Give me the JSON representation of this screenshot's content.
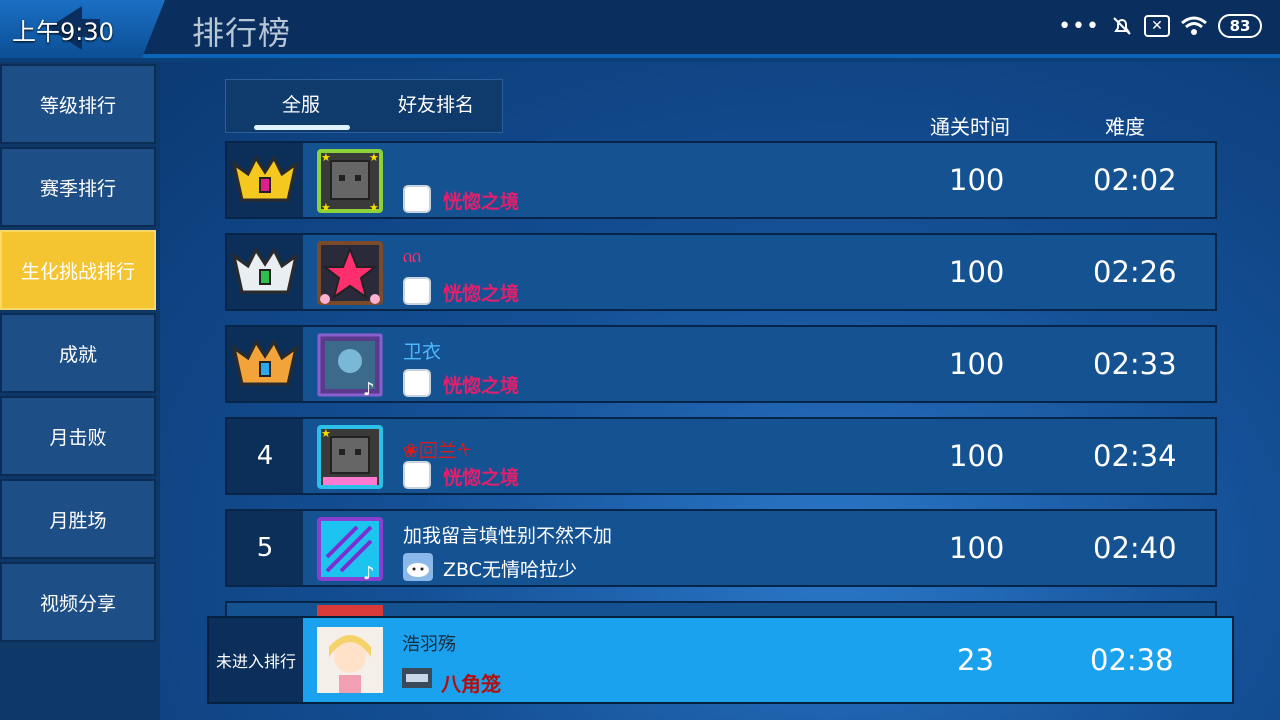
{
  "status_bar": {
    "time": "上午9:30",
    "battery": "83",
    "dots": "•••"
  },
  "header": {
    "title": "排行榜"
  },
  "sidebar": {
    "items": [
      {
        "label": "等级排行"
      },
      {
        "label": "赛季排行"
      },
      {
        "label": "生化挑战排行",
        "active": true
      },
      {
        "label": "成就"
      },
      {
        "label": "月击败"
      },
      {
        "label": "月胜场"
      },
      {
        "label": "视频分享"
      }
    ]
  },
  "tabs": [
    {
      "label": "全服",
      "selected": true
    },
    {
      "label": "好友排名"
    }
  ],
  "columns": {
    "clear_time": "通关时间",
    "difficulty": "难度"
  },
  "rows": [
    {
      "rank": "",
      "medal": "gold",
      "name": "",
      "subtitle": "恍惚之境",
      "score": "100",
      "time": "02:02"
    },
    {
      "rank": "",
      "medal": "silver",
      "name": "ᦶ",
      "subtitle": "恍惚之境",
      "score": "100",
      "time": "02:26"
    },
    {
      "rank": "",
      "medal": "bronze",
      "name": "卫衣",
      "subtitle": "恍惚之境",
      "score": "100",
      "time": "02:33"
    },
    {
      "rank": "4",
      "name": "❀回兰ᠰ",
      "subtitle": "恍惚之境",
      "score": "100",
      "time": "02:34"
    },
    {
      "rank": "5",
      "name": "加我留言填性别不然不加",
      "subtitle": "ZBC无情哈拉少",
      "score": "100",
      "time": "02:40"
    }
  ],
  "self_row": {
    "label": "未进入排行",
    "name": "浩羽殇",
    "subtitle": "八角笼",
    "score": "23",
    "time": "02:38"
  },
  "colors": {
    "accent": "#f5c431",
    "self_row": "#1aa2ef",
    "subtitle_pink": "#e0206e"
  }
}
